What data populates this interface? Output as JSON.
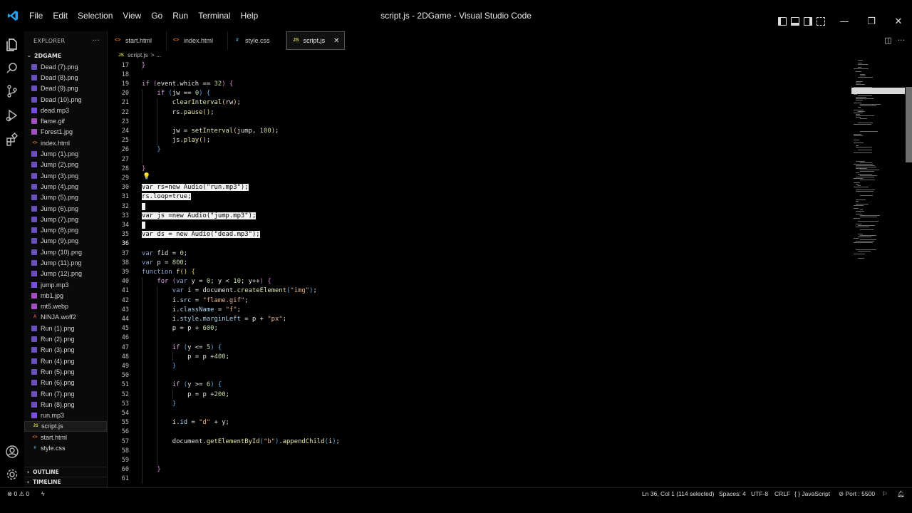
{
  "window": {
    "title": "script.js - 2DGame - Visual Studio Code",
    "minimize": "—",
    "restore": "❐",
    "close": "✕"
  },
  "menu": [
    "File",
    "Edit",
    "Selection",
    "View",
    "Go",
    "Run",
    "Terminal",
    "Help"
  ],
  "sidebar": {
    "header": "EXPLORER",
    "more": "···",
    "folder": "2DGAME",
    "files": [
      {
        "name": "Dead (7).png",
        "type": "png"
      },
      {
        "name": "Dead (8).png",
        "type": "png"
      },
      {
        "name": "Dead (9).png",
        "type": "png"
      },
      {
        "name": "Dead (10).png",
        "type": "png"
      },
      {
        "name": "dead.mp3",
        "type": "mp3"
      },
      {
        "name": "flame.gif",
        "type": "img"
      },
      {
        "name": "Forest1.jpg",
        "type": "img"
      },
      {
        "name": "index.html",
        "type": "html"
      },
      {
        "name": "Jump (1).png",
        "type": "png"
      },
      {
        "name": "Jump (2).png",
        "type": "png"
      },
      {
        "name": "Jump (3).png",
        "type": "png"
      },
      {
        "name": "Jump (4).png",
        "type": "png"
      },
      {
        "name": "Jump (5).png",
        "type": "png"
      },
      {
        "name": "Jump (6).png",
        "type": "png"
      },
      {
        "name": "Jump (7).png",
        "type": "png"
      },
      {
        "name": "Jump (8).png",
        "type": "png"
      },
      {
        "name": "Jump (9).png",
        "type": "png"
      },
      {
        "name": "Jump (10).png",
        "type": "png"
      },
      {
        "name": "Jump (11).png",
        "type": "png"
      },
      {
        "name": "Jump (12).png",
        "type": "png"
      },
      {
        "name": "jump.mp3",
        "type": "mp3"
      },
      {
        "name": "mb1.jpg",
        "type": "img"
      },
      {
        "name": "mt5.webp",
        "type": "img"
      },
      {
        "name": "NINJA.woff2",
        "type": "font"
      },
      {
        "name": "Run (1).png",
        "type": "png"
      },
      {
        "name": "Run (2).png",
        "type": "png"
      },
      {
        "name": "Run (3).png",
        "type": "png"
      },
      {
        "name": "Run (4).png",
        "type": "png"
      },
      {
        "name": "Run (5).png",
        "type": "png"
      },
      {
        "name": "Run (6).png",
        "type": "png"
      },
      {
        "name": "Run (7).png",
        "type": "png"
      },
      {
        "name": "Run (8).png",
        "type": "png"
      },
      {
        "name": "run.mp3",
        "type": "mp3"
      },
      {
        "name": "script.js",
        "type": "js",
        "active": true
      },
      {
        "name": "start.html",
        "type": "html"
      },
      {
        "name": "style.css",
        "type": "css"
      }
    ],
    "outline": "OUTLINE",
    "timeline": "TIMELINE"
  },
  "icon_glyphs": {
    "html": "<>",
    "css": "#",
    "js": "JS",
    "font": "A",
    "png": "",
    "img": "",
    "mp3": ""
  },
  "tabs": [
    {
      "label": "start.html",
      "type": "html"
    },
    {
      "label": "index.html",
      "type": "html"
    },
    {
      "label": "style.css",
      "type": "css"
    },
    {
      "label": "script.js",
      "type": "js",
      "active": true
    }
  ],
  "breadcrumb": {
    "file": "script.js",
    "sep": "> ..."
  },
  "editor": {
    "current_line": 36,
    "lines": [
      {
        "n": 17,
        "indent": 1,
        "html": "<span class=\"br2\">}</span>"
      },
      {
        "n": 18,
        "indent": 0,
        "html": ""
      },
      {
        "n": 19,
        "indent": 0,
        "html": "<span class=\"ctl\">if</span> <span class=\"br2\">(</span>event.which == <span class=\"num\">32</span><span class=\"br2\">)</span> <span class=\"br2\">{</span>"
      },
      {
        "n": 20,
        "indent": 1,
        "html": "    <span class=\"ctl\">if</span> <span class=\"br3\">(</span>jw == <span class=\"num\">0</span><span class=\"br3\">)</span> <span class=\"br3\">{</span>"
      },
      {
        "n": 21,
        "indent": 2,
        "html": "        <span class=\"fn\">clearInterval</span><span class=\"br1\">(</span>rw<span class=\"br1\">)</span>;"
      },
      {
        "n": 22,
        "indent": 2,
        "html": "        rs.<span class=\"fn\">pause</span><span class=\"br1\">()</span>;"
      },
      {
        "n": 23,
        "indent": 2,
        "html": ""
      },
      {
        "n": 24,
        "indent": 2,
        "html": "        jw = <span class=\"fn\">setInterval</span><span class=\"br1\">(</span>jump, <span class=\"num\">100</span><span class=\"br1\">)</span>;"
      },
      {
        "n": 25,
        "indent": 2,
        "html": "        js.<span class=\"fn\">play</span><span class=\"br1\">()</span>;"
      },
      {
        "n": 26,
        "indent": 1,
        "html": "    <span class=\"br3\">}</span>"
      },
      {
        "n": 27,
        "indent": 1,
        "html": ""
      },
      {
        "n": 28,
        "indent": 0,
        "html": "<span class=\"br2\">}</span>"
      },
      {
        "n": 29,
        "indent": 0,
        "html": ""
      },
      {
        "n": 30,
        "indent": 0,
        "html": "<span class=\"sel\">var rs=new Audio(\"run.mp3\");</span>"
      },
      {
        "n": 31,
        "indent": 0,
        "html": "<span class=\"sel\">rs.loop=true;</span>"
      },
      {
        "n": 32,
        "indent": 0,
        "html": "<span class=\"sel\"> </span>"
      },
      {
        "n": 33,
        "indent": 0,
        "html": "<span class=\"sel\">var js =new Audio(\"jump.mp3\");</span>"
      },
      {
        "n": 34,
        "indent": 0,
        "html": "<span class=\"sel\"> </span>"
      },
      {
        "n": 35,
        "indent": 0,
        "html": "<span class=\"sel\">var ds = new Audio(\"dead.mp3\");</span>"
      },
      {
        "n": 36,
        "indent": 0,
        "html": ""
      },
      {
        "n": 37,
        "indent": 0,
        "html": "<span class=\"kw\">var</span> fid = <span class=\"num\">0</span>;"
      },
      {
        "n": 38,
        "indent": 0,
        "html": "<span class=\"kw\">var</span> p = <span class=\"num\">800</span>;"
      },
      {
        "n": 39,
        "indent": 0,
        "html": "<span class=\"kw\">function</span> <span class=\"fn\">f</span><span class=\"br1\">()</span> <span class=\"br1\">{</span>"
      },
      {
        "n": 40,
        "indent": 1,
        "html": "    <span class=\"ctl\">for</span> <span class=\"br2\">(</span><span class=\"kw\">var</span> y = <span class=\"num\">0</span>; y &lt; <span class=\"num\">10</span>; y++<span class=\"br2\">)</span> <span class=\"br2\">{</span>"
      },
      {
        "n": 41,
        "indent": 2,
        "html": "        <span class=\"kw\">var</span> i = document.<span class=\"fn\">createElement</span><span class=\"br3\">(</span><span class=\"str\">\"img\"</span><span class=\"br3\">)</span>;"
      },
      {
        "n": 42,
        "indent": 2,
        "html": "        i.<span class=\"prop\">src</span> = <span class=\"str\">\"flame.gif\"</span>;"
      },
      {
        "n": 43,
        "indent": 2,
        "html": "        i.<span class=\"prop\">className</span> = <span class=\"str\">\"f\"</span>;"
      },
      {
        "n": 44,
        "indent": 2,
        "html": "        i.<span class=\"prop\">style</span>.<span class=\"prop\">marginLeft</span> = p + <span class=\"str\">\"px\"</span>;"
      },
      {
        "n": 45,
        "indent": 2,
        "html": "        p = p + <span class=\"num\">600</span>;"
      },
      {
        "n": 46,
        "indent": 2,
        "html": ""
      },
      {
        "n": 47,
        "indent": 2,
        "html": "        <span class=\"ctl\">if</span> <span class=\"br3\">(</span>y &lt;= <span class=\"num\">5</span><span class=\"br3\">)</span> <span class=\"br3\">{</span>"
      },
      {
        "n": 48,
        "indent": 3,
        "html": "            p = p +<span class=\"num\">400</span>;"
      },
      {
        "n": 49,
        "indent": 2,
        "html": "        <span class=\"br3\">}</span>"
      },
      {
        "n": 50,
        "indent": 2,
        "html": ""
      },
      {
        "n": 51,
        "indent": 2,
        "html": "        <span class=\"ctl\">if</span> <span class=\"br3\">(</span>y &gt;= <span class=\"num\">6</span><span class=\"br3\">)</span> <span class=\"br3\">{</span>"
      },
      {
        "n": 52,
        "indent": 3,
        "html": "            p = p +<span class=\"num\">200</span>;"
      },
      {
        "n": 53,
        "indent": 2,
        "html": "        <span class=\"br3\">}</span>"
      },
      {
        "n": 54,
        "indent": 2,
        "html": ""
      },
      {
        "n": 55,
        "indent": 2,
        "html": "        i.<span class=\"prop\">id</span> = <span class=\"str\">\"d\"</span> + y;"
      },
      {
        "n": 56,
        "indent": 2,
        "html": ""
      },
      {
        "n": 57,
        "indent": 2,
        "html": "        document.<span class=\"fn\">getElementById</span><span class=\"br3\">(</span><span class=\"str\">\"b\"</span><span class=\"br3\">)</span>.<span class=\"fn\">appendChild</span><span class=\"br3\">(</span>i<span class=\"br3\">)</span>;"
      },
      {
        "n": 58,
        "indent": 2,
        "html": ""
      },
      {
        "n": 59,
        "indent": 2,
        "html": ""
      },
      {
        "n": 60,
        "indent": 1,
        "html": "    <span class=\"br2\">}</span>"
      },
      {
        "n": 61,
        "indent": 1,
        "html": ""
      }
    ]
  },
  "status": {
    "errors": "⊗ 0 ⚠ 0",
    "cursor": "Ln 36, Col 1 (114 selected)",
    "spaces": "Spaces: 4",
    "encoding": "UTF-8",
    "eol": "CRLF",
    "language": "{ } JavaScript",
    "port": "⊘ Port : 5500"
  },
  "colors": {
    "accent": "#007acc",
    "js": "#cbcb41",
    "html": "#e37933",
    "css": "#519aba"
  }
}
